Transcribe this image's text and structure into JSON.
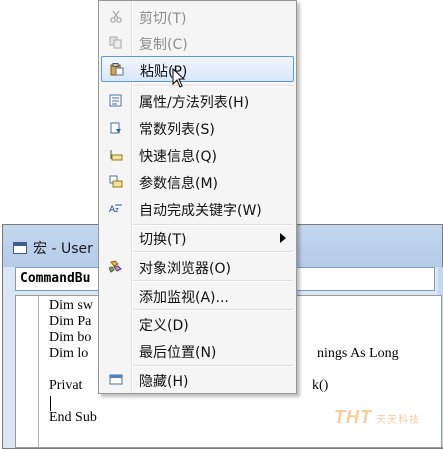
{
  "window": {
    "title": "宏 - User",
    "object_combo": "CommandBu"
  },
  "code": {
    "lines": [
      "Dim sw",
      "Dim Pa",
      "Dim bo",
      "Dim lo",
      "",
      "Privat",
      "",
      "End Sub"
    ],
    "line4_tail": "nings As Long",
    "line6_tail": "k()"
  },
  "watermark": {
    "logo": "THT",
    "tagline": "天天科技"
  },
  "context_menu": {
    "items": [
      {
        "id": "cut",
        "label": "剪切(T)",
        "icon": "scissors-icon",
        "disabled": true
      },
      {
        "id": "copy",
        "label": "复制(C)",
        "icon": "copy-icon",
        "disabled": true
      },
      {
        "id": "paste",
        "label": "粘贴(P)",
        "icon": "paste-icon",
        "highlighted": true
      },
      {
        "id": "properties-methods",
        "label": "属性/方法列表(H)",
        "icon": "list-members-icon"
      },
      {
        "id": "constants",
        "label": "常数列表(S)",
        "icon": "list-constants-icon"
      },
      {
        "id": "quick-info",
        "label": "快速信息(Q)",
        "icon": "quick-info-icon"
      },
      {
        "id": "parameter-info",
        "label": "参数信息(M)",
        "icon": "parameter-info-icon"
      },
      {
        "id": "complete-word",
        "label": "自动完成关键字(W)",
        "icon": "complete-word-icon"
      },
      {
        "id": "toggle",
        "label": "切换(T)",
        "submenu": true
      },
      {
        "id": "object-browser",
        "label": "对象浏览器(O)",
        "icon": "object-browser-icon"
      },
      {
        "id": "add-watch",
        "label": "添加监视(A)..."
      },
      {
        "id": "definition",
        "label": "定义(D)"
      },
      {
        "id": "last-position",
        "label": "最后位置(N)"
      },
      {
        "id": "hide",
        "label": "隐藏(H)",
        "icon": "window-icon"
      }
    ]
  }
}
